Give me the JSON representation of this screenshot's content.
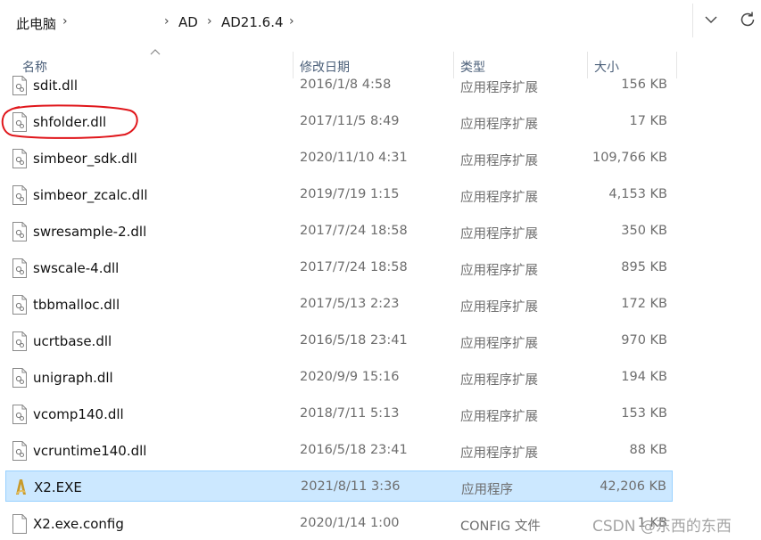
{
  "address_bar": {
    "crumbs": [
      "此电脑",
      "",
      "AD",
      "AD21.6.4"
    ],
    "separator": "›"
  },
  "columns": {
    "name": "名称",
    "date": "修改日期",
    "type": "类型",
    "size": "大小"
  },
  "files": [
    {
      "name": "sdit.dll",
      "date": "2016/1/8 4:58",
      "type": "应用程序扩展",
      "size": "156 KB",
      "icon": "dll-file-icon"
    },
    {
      "name": "shfolder.dll",
      "date": "2017/11/5 8:49",
      "type": "应用程序扩展",
      "size": "17 KB",
      "icon": "dll-file-icon"
    },
    {
      "name": "simbeor_sdk.dll",
      "date": "2020/11/10 4:31",
      "type": "应用程序扩展",
      "size": "109,766 KB",
      "icon": "dll-file-icon"
    },
    {
      "name": "simbeor_zcalc.dll",
      "date": "2019/7/19 1:15",
      "type": "应用程序扩展",
      "size": "4,153 KB",
      "icon": "dll-file-icon"
    },
    {
      "name": "swresample-2.dll",
      "date": "2017/7/24 18:58",
      "type": "应用程序扩展",
      "size": "350 KB",
      "icon": "dll-file-icon"
    },
    {
      "name": "swscale-4.dll",
      "date": "2017/7/24 18:58",
      "type": "应用程序扩展",
      "size": "895 KB",
      "icon": "dll-file-icon"
    },
    {
      "name": "tbbmalloc.dll",
      "date": "2017/5/13 2:23",
      "type": "应用程序扩展",
      "size": "172 KB",
      "icon": "dll-file-icon"
    },
    {
      "name": "ucrtbase.dll",
      "date": "2016/5/18 23:41",
      "type": "应用程序扩展",
      "size": "970 KB",
      "icon": "dll-file-icon"
    },
    {
      "name": "unigraph.dll",
      "date": "2020/9/9 15:16",
      "type": "应用程序扩展",
      "size": "194 KB",
      "icon": "dll-file-icon"
    },
    {
      "name": "vcomp140.dll",
      "date": "2018/7/11 5:13",
      "type": "应用程序扩展",
      "size": "153 KB",
      "icon": "dll-file-icon"
    },
    {
      "name": "vcruntime140.dll",
      "date": "2016/5/18 23:41",
      "type": "应用程序扩展",
      "size": "88 KB",
      "icon": "dll-file-icon"
    },
    {
      "name": "X2.EXE",
      "date": "2021/8/11 3:36",
      "type": "应用程序",
      "size": "42,206 KB",
      "icon": "altium-exe-icon",
      "selected": true
    },
    {
      "name": "X2.exe.config",
      "date": "2020/1/14 1:00",
      "type": "CONFIG 文件",
      "size": "1 KB",
      "icon": "config-file-icon"
    }
  ],
  "watermark": "CSDN @东西的东西",
  "colors": {
    "selection_bg": "#cce8ff",
    "selection_border": "#99d1ff",
    "annotation_red": "#e0161b"
  }
}
